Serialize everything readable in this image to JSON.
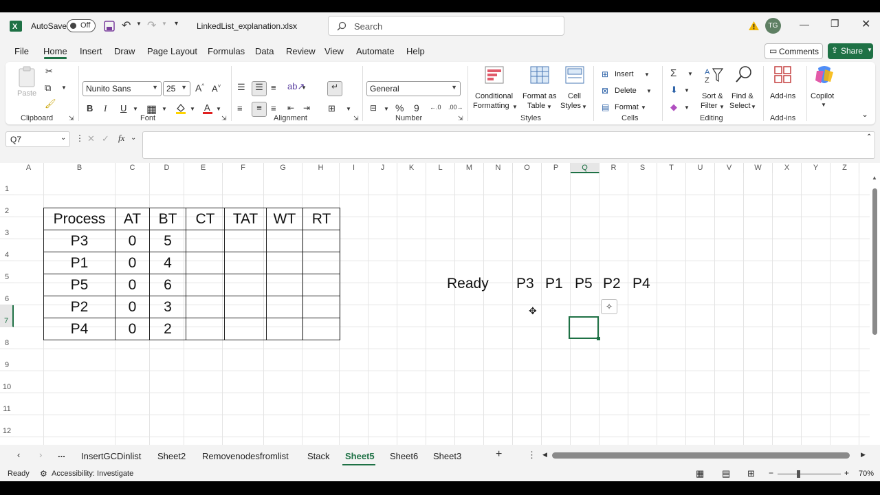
{
  "titlebar": {
    "autosave_label": "AutoSave",
    "autosave_state": "Off",
    "filename": "LinkedList_explanation.xlsx",
    "search_placeholder": "Search",
    "user_initials": "TG",
    "excel_icon": "excel-logo-icon",
    "accent_color": "#1e7145"
  },
  "menu": {
    "tabs": [
      "File",
      "Home",
      "Insert",
      "Draw",
      "Page Layout",
      "Formulas",
      "Data",
      "Review",
      "View",
      "Automate",
      "Help"
    ],
    "active": "Home",
    "comments_label": "Comments",
    "share_label": "Share"
  },
  "ribbon": {
    "clipboard": {
      "paste": "Paste",
      "label": "Clipboard"
    },
    "font": {
      "name": "Nunito Sans",
      "size": "25",
      "label": "Font",
      "bold": "B",
      "italic": "I",
      "underline": "U"
    },
    "alignment": {
      "label": "Alignment"
    },
    "number": {
      "format": "General",
      "label": "Number"
    },
    "styles": {
      "conditional": "Conditional",
      "conditional2": "Formatting",
      "format_as": "Format as",
      "format_as2": "Table",
      "cell": "Cell",
      "cell2": "Styles",
      "label": "Styles"
    },
    "cells": {
      "insert": "Insert",
      "delete": "Delete",
      "format": "Format",
      "label": "Cells"
    },
    "editing": {
      "sort": "Sort &",
      "sort2": "Filter",
      "find": "Find &",
      "find2": "Select",
      "label": "Editing"
    },
    "addins": {
      "btn": "Add-ins",
      "label": "Add-ins"
    },
    "copilot": {
      "label": "Copilot"
    }
  },
  "formula_bar": {
    "name_box": "Q7",
    "fx": "fx",
    "value": ""
  },
  "grid": {
    "columns": [
      "A",
      "B",
      "C",
      "D",
      "E",
      "F",
      "G",
      "H",
      "I",
      "J",
      "K",
      "L",
      "M",
      "N",
      "O",
      "P",
      "Q",
      "R",
      "S",
      "T",
      "U",
      "V",
      "W",
      "X",
      "Y",
      "Z"
    ],
    "rows": [
      "1",
      "2",
      "3",
      "4",
      "5",
      "6",
      "7",
      "8",
      "9",
      "10",
      "11",
      "12"
    ],
    "table": {
      "headers": [
        "Process",
        "AT",
        "BT",
        "CT",
        "TAT",
        "WT",
        "RT"
      ],
      "rows": [
        [
          "P3",
          "0",
          "5",
          "",
          "",
          "",
          ""
        ],
        [
          "P1",
          "0",
          "4",
          "",
          "",
          "",
          ""
        ],
        [
          "P5",
          "0",
          "6",
          "",
          "",
          "",
          ""
        ],
        [
          "P2",
          "0",
          "3",
          "",
          "",
          "",
          ""
        ],
        [
          "P4",
          "0",
          "2",
          "",
          "",
          "",
          ""
        ]
      ]
    },
    "ready_label": "Ready",
    "queue": [
      "P3",
      "P1",
      "P5",
      "P2",
      "P4"
    ]
  },
  "sheets": {
    "tabs": [
      "InsertGCDinlist",
      "Sheet2",
      "Removenodesfromlist",
      "Stack",
      "Sheet5",
      "Sheet6",
      "Sheet3"
    ],
    "active": "Sheet5",
    "more": "..."
  },
  "status": {
    "ready": "Ready",
    "accessibility": "Accessibility: Investigate",
    "zoom": "70%"
  }
}
